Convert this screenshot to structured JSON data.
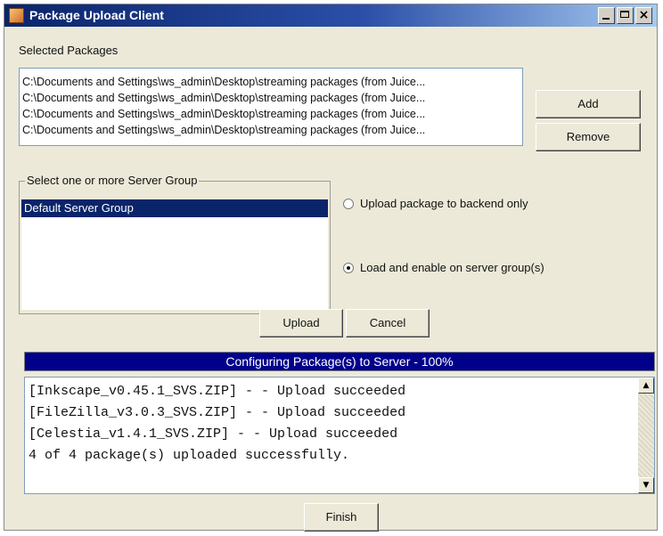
{
  "window": {
    "title": "Package Upload Client"
  },
  "selected_packages": {
    "label": "Selected Packages",
    "items": [
      "C:\\Documents and Settings\\ws_admin\\Desktop\\streaming packages (from Juice...",
      "C:\\Documents and Settings\\ws_admin\\Desktop\\streaming packages (from Juice...",
      "C:\\Documents and Settings\\ws_admin\\Desktop\\streaming packages (from Juice...",
      "C:\\Documents and Settings\\ws_admin\\Desktop\\streaming packages (from Juice..."
    ]
  },
  "buttons": {
    "add": "Add",
    "remove": "Remove",
    "upload": "Upload",
    "cancel": "Cancel",
    "finish": "Finish"
  },
  "server_group": {
    "legend": "Select one or more Server Group",
    "items": [
      {
        "label": "Default Server Group",
        "selected": true
      }
    ]
  },
  "upload_options": [
    {
      "label": "Upload package to backend only",
      "selected": false
    },
    {
      "label": "Load and enable on server group(s)",
      "selected": true
    }
  ],
  "progress": {
    "label": "Configuring Package(s) to Server - 100%",
    "percent": 100,
    "fill_color": "#00008b"
  },
  "log": {
    "lines": [
      "[Inkscape_v0.45.1_SVS.ZIP] -  - Upload succeeded",
      "[FileZilla_v3.0.3_SVS.ZIP] -  - Upload succeeded",
      "[Celestia_v1.4.1_SVS.ZIP] -  - Upload succeeded",
      "4 of 4 package(s) uploaded successfully."
    ]
  },
  "icons": {
    "title_icon": "app-icon",
    "minimize": "minimize-icon",
    "maximize": "maximize-icon",
    "close": "close-icon",
    "scroll_up": "scroll-up-icon",
    "scroll_down": "scroll-down-icon"
  },
  "colors": {
    "selection": "#0a246a",
    "window_bg": "#ece9d8"
  }
}
